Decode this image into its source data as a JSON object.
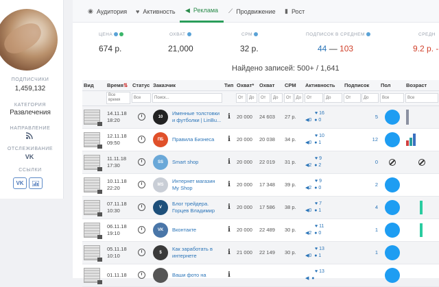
{
  "sidebar": {
    "subscribers_label": "ПОДПИСЧИКИ",
    "subscribers_value": "1,459,132",
    "category_label": "КАТЕГОРИЯ",
    "category_value": "Развлечения",
    "direction_label": "НАПРАВЛЕНИЕ",
    "tracking_label": "ОТСЛЕЖИВАНИЕ",
    "links_label": "ССЫЛКИ"
  },
  "tabs": [
    {
      "label": "Аудитория",
      "icon": "globe-icon"
    },
    {
      "label": "Активность",
      "icon": "heart-icon"
    },
    {
      "label": "Реклама",
      "icon": "megaphone-icon",
      "active": true
    },
    {
      "label": "Продвижение",
      "icon": "chart-line-icon"
    },
    {
      "label": "Рост",
      "icon": "chart-bar-icon"
    }
  ],
  "stats": {
    "price_label": "ЦЕНА",
    "price_value": "674 р.",
    "reach_label": "ОХВАТ",
    "reach_value": "21,000",
    "cpm_label": "CPM",
    "cpm_value": "32 р.",
    "subs_label": "ПОДПИСОК В СРЕДНЕМ",
    "subs_low": "44",
    "subs_dash": "—",
    "subs_high": "103",
    "avg_label": "СРЕДН",
    "avg_value": "9.2 р. -"
  },
  "total_text": "Найдено записей: 500+ / 1,641",
  "table": {
    "headers": [
      "Вид",
      "Время",
      "Статус",
      "Заказчик",
      "Тип",
      "Охват*",
      "Охват",
      "CPM",
      "Активность",
      "Подписок",
      "Пол",
      "Возраст"
    ],
    "filters": {
      "time": "Все время",
      "status": "Все",
      "customer": "Поиск...",
      "from": "От",
      "to": "До"
    },
    "rows": [
      {
        "date": "14.11.18",
        "time": "18:20",
        "name": "Именные толстовки и футболки | LinBu...",
        "logo_text": "10",
        "logo_color": "#222222",
        "reach_est": "20 000",
        "reach": "24 603",
        "cpm": "27 р.",
        "likes": "16",
        "reposts": "0",
        "comments": "0",
        "subs": "5",
        "gender": "circle"
      },
      {
        "date": "12.11.18",
        "time": "09:50",
        "name": "Правила Бизнеса",
        "logo_text": "ПБ",
        "logo_color": "#e0502a",
        "reach_est": "20 000",
        "reach": "20 038",
        "cpm": "34 р.",
        "likes": "10",
        "reposts": "0",
        "comments": "1",
        "subs": "12",
        "gender": "circle"
      },
      {
        "date": "11.11.18",
        "time": "17:30",
        "name": "Smart shop",
        "logo_text": "SS",
        "logo_color": "#6aa8d8",
        "reach_est": "20 000",
        "reach": "22 019",
        "cpm": "31 р.",
        "likes": "9",
        "reposts": "2",
        "comments": "2",
        "subs": "0",
        "gender": "ban"
      },
      {
        "date": "10.11.18",
        "time": "22:20",
        "name": "Интернет магазин My Shop",
        "logo_text": "MS",
        "logo_color": "#c9ced6",
        "reach_est": "20 000",
        "reach": "17 348",
        "cpm": "39 р.",
        "likes": "9",
        "reposts": "2",
        "comments": "0",
        "subs": "2",
        "gender": "circle"
      },
      {
        "date": "07.11.18",
        "time": "10:30",
        "name": "Блог трейдера. Горцев Владимир",
        "logo_text": "V",
        "logo_color": "#1d4f7a",
        "reach_est": "20 000",
        "reach": "17 586",
        "cpm": "38 р.",
        "likes": "7",
        "reposts": "0",
        "comments": "1",
        "subs": "4",
        "gender": "circle"
      },
      {
        "date": "06.11.18",
        "time": "19:10",
        "name": "Вконтакте",
        "logo_text": "VK",
        "logo_color": "#4a76a8",
        "reach_est": "20 000",
        "reach": "22 489",
        "cpm": "30 р.",
        "likes": "11",
        "reposts": "2",
        "comments": "0",
        "subs": "1",
        "gender": "circle"
      },
      {
        "date": "05.11.18",
        "time": "10:10",
        "name": "Как заработать в интернете",
        "logo_text": "$",
        "logo_color": "#3a3a3a",
        "reach_est": "21 000",
        "reach": "22 149",
        "cpm": "30 р.",
        "likes": "13",
        "reposts": "0",
        "comments": "1",
        "subs": "1",
        "gender": "circle"
      },
      {
        "date": "01.11.18",
        "time": "",
        "name": "Ваши фото на",
        "logo_text": "",
        "logo_color": "#555555",
        "reach_est": "",
        "reach": "",
        "cpm": "",
        "likes": "13",
        "reposts": "",
        "comments": "",
        "subs": "",
        "gender": "circle"
      }
    ]
  },
  "colors": {
    "accent": "#2a9d5a",
    "link": "#2a74b8",
    "circle": "#1e9df2",
    "subs_high": "#d0402a",
    "avg": "#d0402a"
  }
}
